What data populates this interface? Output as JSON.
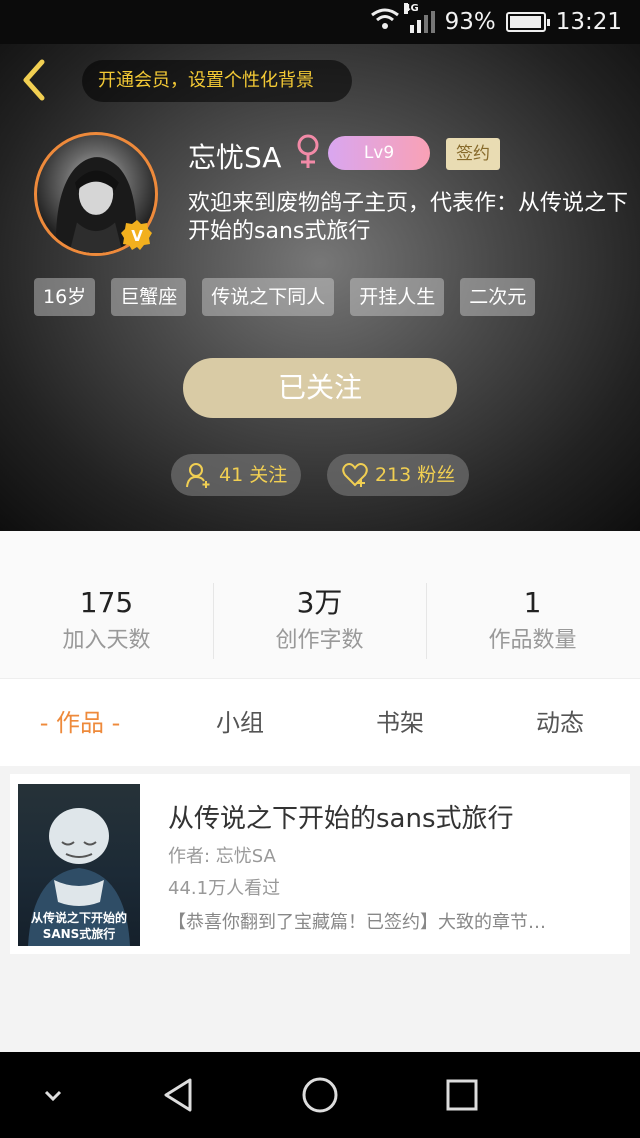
{
  "status_bar": {
    "network": "4G",
    "battery": "93%",
    "time": "13:21"
  },
  "header": {
    "vip_banner": "开通会员，设置个性化背景",
    "nickname": "忘忧SA",
    "level": "Lv9",
    "sign_badge": "签约",
    "intro": "欢迎来到废物鸽子主页，代表作：从传说之下开始的sans式旅行",
    "tags": [
      "16岁",
      "巨蟹座",
      "传说之下同人",
      "开挂人生",
      "二次元"
    ],
    "follow_button": "已关注",
    "following": "41 关注",
    "fans": "213 粉丝"
  },
  "stats": [
    {
      "value": "175",
      "label": "加入天数"
    },
    {
      "value": "3万",
      "label": "创作字数"
    },
    {
      "value": "1",
      "label": "作品数量"
    }
  ],
  "tabs": [
    "- 作品 -",
    "小组",
    "书架",
    "动态"
  ],
  "work": {
    "cover_title": "从传说之下开始的SANS式旅行",
    "title": "从传说之下开始的sans式旅行",
    "author": "作者: 忘忧SA",
    "views": "44.1万人看过",
    "description": "【恭喜你翻到了宝藏篇！已签约】大致的章节…"
  },
  "colors": {
    "accent": "#ee8a3b",
    "gold": "#f1cf52",
    "follow_button": "#d9cba5"
  },
  "icons": [
    "back-arrow-icon",
    "wifi-icon",
    "signal-icon",
    "battery-icon",
    "female-icon",
    "verified-v-icon",
    "add-user-icon",
    "heart-icon",
    "nav-down-icon",
    "nav-back-icon",
    "nav-home-icon",
    "nav-recent-icon"
  ]
}
